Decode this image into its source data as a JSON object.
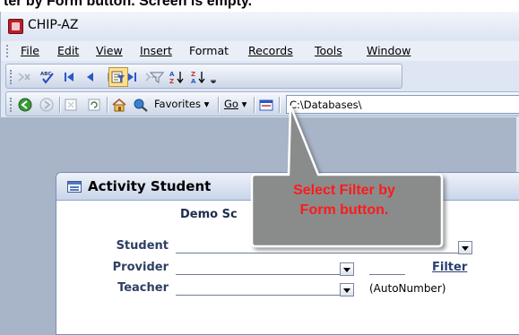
{
  "caption": {
    "visible_text": "ter by Form button. Screen is empty."
  },
  "window": {
    "title": "CHIP-AZ",
    "icon": "access-app-icon"
  },
  "menubar": {
    "items": [
      {
        "label": "File",
        "underline": "F"
      },
      {
        "label": "Edit",
        "underline": "E"
      },
      {
        "label": "View",
        "underline": "V"
      },
      {
        "label": "Insert",
        "underline": "I"
      },
      {
        "label": "Format",
        "underline": "o"
      },
      {
        "label": "Records",
        "underline": "R"
      },
      {
        "label": "Tools",
        "underline": "T"
      },
      {
        "label": "Window",
        "underline": "W"
      }
    ]
  },
  "toolbar_records": {
    "buttons": [
      "delete-record-icon",
      "spelling-icon",
      "first-record-icon",
      "previous-record-icon",
      "next-record-icon",
      "last-record-icon",
      "new-record-icon",
      "filter-by-form-icon",
      "apply-filter-icon",
      "sort-ascending-icon",
      "sort-descending-icon",
      "toolbar-options-icon"
    ],
    "active": "filter-by-form-icon"
  },
  "toolbar_web": {
    "favorites_label": "Favorites",
    "go_label": "Go",
    "address": "C:\\Databases\\"
  },
  "form": {
    "title": "Activity Student",
    "header_text": "Demo Sc",
    "fields": [
      {
        "label": "Student"
      },
      {
        "label": "Provider"
      },
      {
        "label": "Teacher"
      }
    ],
    "filter_link": "Filter",
    "autonumber": "(AutoNumber)"
  },
  "callout": {
    "line1": "Select Filter by",
    "line2": "Form button."
  },
  "colors": {
    "callout_fill": "#8a8c8c",
    "callout_text": "#ff1a1a",
    "active_button_fill": "#ffe092",
    "form_label": "#2e3f63"
  }
}
